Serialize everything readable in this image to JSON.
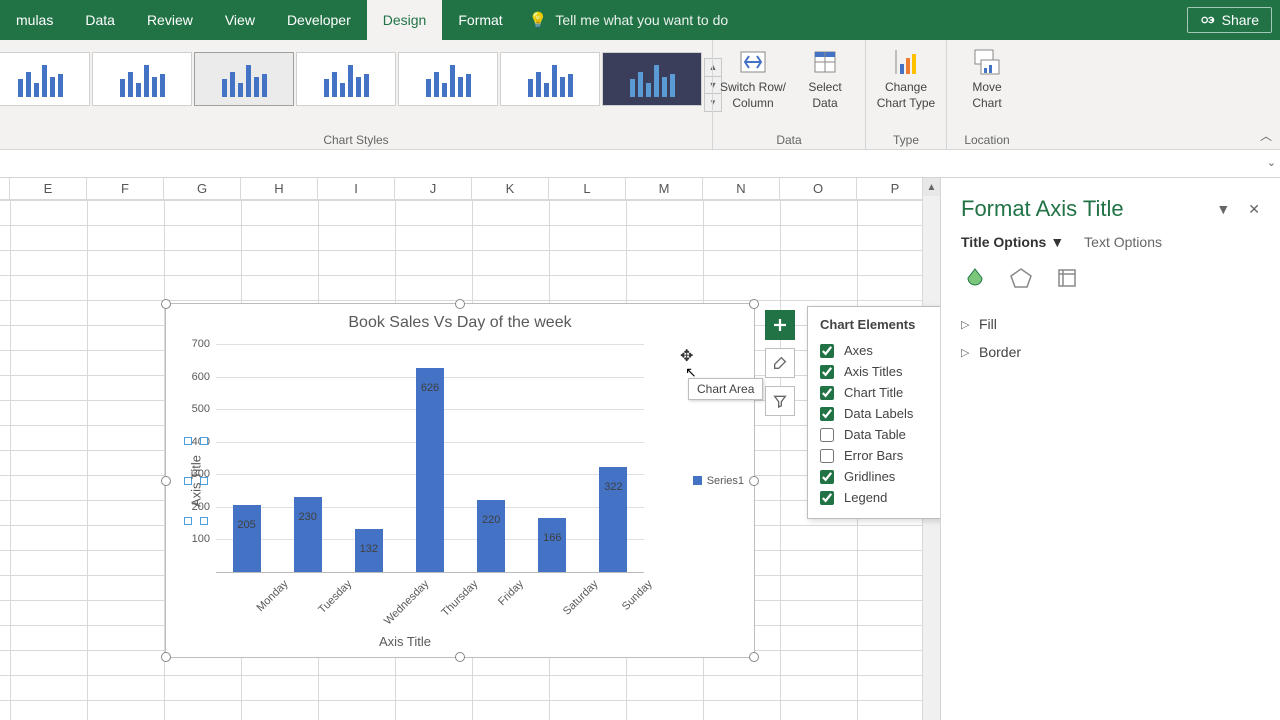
{
  "ribbon": {
    "tabs": [
      "mulas",
      "Data",
      "Review",
      "View",
      "Developer",
      "Design",
      "Format"
    ],
    "active_tab_index": 5,
    "tell_me": "Tell me what you want to do",
    "share": "Share",
    "groups": {
      "chart_styles": "Chart Styles",
      "data": "Data",
      "type": "Type",
      "location": "Location"
    },
    "buttons": {
      "switch_row_col_l1": "Switch Row/",
      "switch_row_col_l2": "Column",
      "select_data_l1": "Select",
      "select_data_l2": "Data",
      "change_type_l1": "Change",
      "change_type_l2": "Chart Type",
      "move_chart_l1": "Move",
      "move_chart_l2": "Chart"
    }
  },
  "columns": [
    "E",
    "F",
    "G",
    "H",
    "I",
    "J",
    "K",
    "L",
    "M",
    "N",
    "O",
    "P"
  ],
  "chart_data": {
    "type": "bar",
    "title": "Book Sales Vs Day of the week",
    "categories": [
      "Monday",
      "Tuesday",
      "Wednesday",
      "Thursday",
      "Friday",
      "Saturday",
      "Sunday"
    ],
    "values": [
      205,
      230,
      132,
      626,
      220,
      166,
      322
    ],
    "series_name": "Series1",
    "xlabel": "Axis Title",
    "ylabel": "Axis Title",
    "ylim": [
      0,
      700
    ],
    "ytick_step": 100,
    "yticks": [
      "700",
      "600",
      "500",
      "400",
      "300",
      "200",
      "100"
    ]
  },
  "tooltip": "Chart Area",
  "chart_elements": {
    "title": "Chart Elements",
    "items": [
      {
        "label": "Axes",
        "checked": true
      },
      {
        "label": "Axis Titles",
        "checked": true
      },
      {
        "label": "Chart Title",
        "checked": true
      },
      {
        "label": "Data Labels",
        "checked": true
      },
      {
        "label": "Data Table",
        "checked": false
      },
      {
        "label": "Error Bars",
        "checked": false
      },
      {
        "label": "Gridlines",
        "checked": true
      },
      {
        "label": "Legend",
        "checked": true
      }
    ]
  },
  "format_pane": {
    "title": "Format Axis Title",
    "tab1": "Title Options",
    "tab2": "Text Options",
    "fill": "Fill",
    "border": "Border"
  }
}
